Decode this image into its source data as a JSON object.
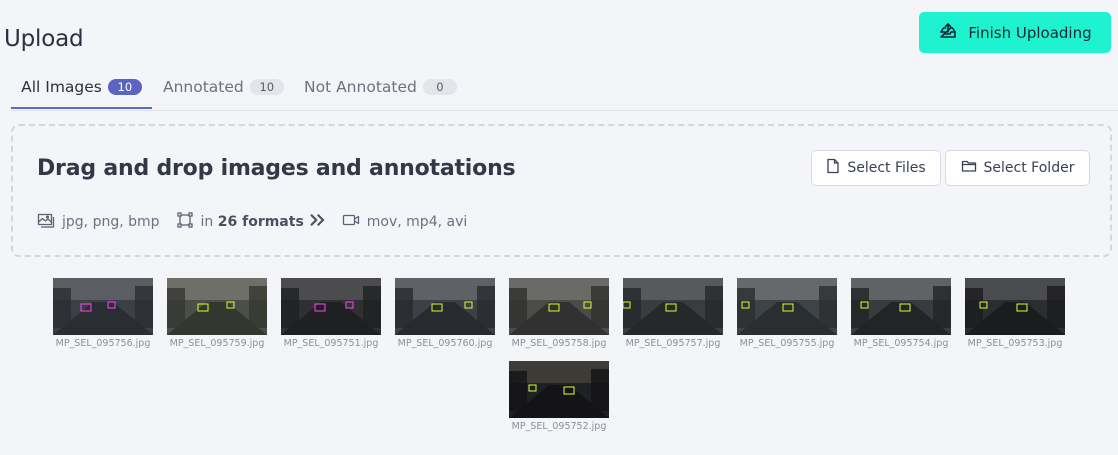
{
  "header": {
    "title": "Upload",
    "finish_label": "Finish Uploading"
  },
  "tabs": [
    {
      "label": "All Images",
      "count": "10"
    },
    {
      "label": "Annotated",
      "count": "10"
    },
    {
      "label": "Not Annotated",
      "count": "0"
    }
  ],
  "dropzone": {
    "title": "Drag and drop images and annotations",
    "select_files": "Select Files",
    "select_folder": "Select Folder",
    "image_formats": "jpg, png, bmp",
    "annotation_prefix": "in",
    "annotation_formats": "26 formats",
    "video_formats": "mov, mp4, avi"
  },
  "images": [
    {
      "name": "MP_SEL_095756.jpg"
    },
    {
      "name": "MP_SEL_095759.jpg"
    },
    {
      "name": "MP_SEL_095751.jpg"
    },
    {
      "name": "MP_SEL_095760.jpg"
    },
    {
      "name": "MP_SEL_095758.jpg"
    },
    {
      "name": "MP_SEL_095757.jpg"
    },
    {
      "name": "MP_SEL_095755.jpg"
    },
    {
      "name": "MP_SEL_095754.jpg"
    },
    {
      "name": "MP_SEL_095753.jpg"
    },
    {
      "name": "MP_SEL_095752.jpg"
    }
  ],
  "colors": {
    "accent": "#1ff2d0",
    "tab_active": "#5b64c1"
  }
}
